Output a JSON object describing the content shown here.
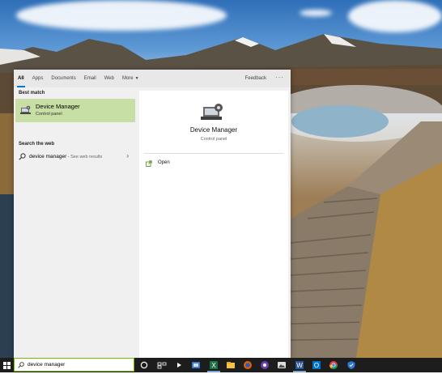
{
  "search": {
    "filters": [
      "All",
      "Apps",
      "Documents",
      "Email",
      "Web",
      "More"
    ],
    "feedback": "Feedback",
    "overflow": "···",
    "best_match_heading": "Best match",
    "best_match": {
      "title": "Device Manager",
      "subtitle": "Control panel",
      "icon": "device-manager-icon"
    },
    "web_heading": "Search the web",
    "web_result": {
      "query": "device manager",
      "suffix": " - See web results"
    },
    "detail": {
      "title": "Device Manager",
      "subtitle": "Control panel",
      "action": "Open"
    }
  },
  "taskbar": {
    "query": "device manager",
    "icons": [
      "windows-start-icon",
      "search-icon",
      "cortana-icon",
      "task-view-icon",
      "media-player-icon",
      "app-icon",
      "excel-icon",
      "file-explorer-icon",
      "firefox-icon",
      "app-icon",
      "app-icon",
      "word-icon",
      "outlook-icon",
      "chrome-icon",
      "shield-icon"
    ]
  },
  "colors": {
    "accent": "#0078d7",
    "selection": "#c7dea4",
    "search_border": "#76b900",
    "taskbar": "#1d1d1d"
  }
}
